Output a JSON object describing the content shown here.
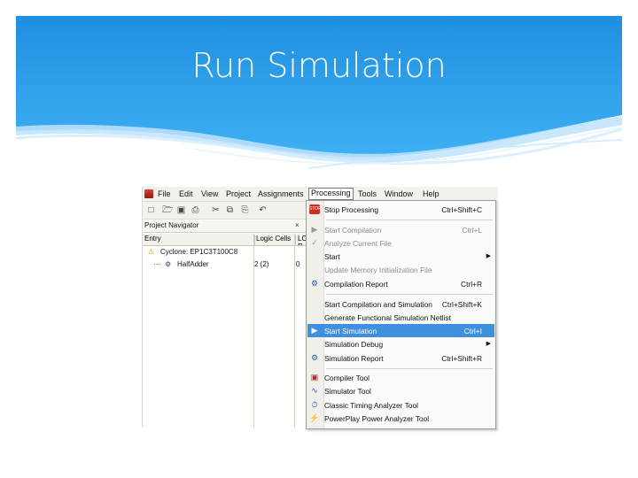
{
  "slide": {
    "title": "Run Simulation"
  },
  "colors": {
    "header_top": "#1f8fe0",
    "header_bottom": "#3fb0f3",
    "menu_highlight": "#3d8fe0"
  },
  "menubar": {
    "items": [
      "File",
      "Edit",
      "View",
      "Project",
      "Assignments",
      "Processing",
      "Tools",
      "Window",
      "Help"
    ],
    "active": "Processing"
  },
  "toolbar": {
    "icons": [
      "new-icon",
      "open-icon",
      "save-icon",
      "print-icon",
      "cut-icon",
      "copy-icon",
      "paste-icon",
      "undo-icon"
    ]
  },
  "project_navigator": {
    "title": "Project Navigator",
    "columns": [
      "Entry",
      "Logic Cells",
      "LC R"
    ],
    "rows": [
      {
        "entry": "Cyclone: EP1C3T100C8",
        "logic_cells": "",
        "lc": ""
      },
      {
        "entry": "HalfAdder",
        "logic_cells": "2 (2)",
        "lc": "0"
      }
    ]
  },
  "processing_menu": {
    "items": [
      {
        "label": "Stop Processing",
        "shortcut": "Ctrl+Shift+C",
        "icon": "stop-icon",
        "disabled": false
      },
      {
        "sep": true
      },
      {
        "label": "Start Compilation",
        "shortcut": "Ctrl+L",
        "icon": "play-icon",
        "disabled": true
      },
      {
        "label": "Analyze Current File",
        "shortcut": "",
        "icon": "analyze-icon",
        "disabled": true
      },
      {
        "label": "Start",
        "shortcut": "",
        "icon": "",
        "disabled": false,
        "submenu": true
      },
      {
        "label": "Update Memory Initialization File",
        "shortcut": "",
        "icon": "",
        "disabled": true
      },
      {
        "label": "Compilation Report",
        "shortcut": "Ctrl+R",
        "icon": "report-icon",
        "disabled": false
      },
      {
        "sep": true
      },
      {
        "label": "Start Compilation and Simulation",
        "shortcut": "Ctrl+Shift+K",
        "icon": "",
        "disabled": false
      },
      {
        "label": "Generate Functional Simulation Netlist",
        "shortcut": "",
        "icon": "",
        "disabled": false
      },
      {
        "label": "Start Simulation",
        "shortcut": "Ctrl+I",
        "icon": "simulate-icon",
        "disabled": false,
        "highlighted": true
      },
      {
        "label": "Simulation Debug",
        "shortcut": "",
        "icon": "",
        "disabled": false,
        "submenu": true
      },
      {
        "label": "Simulation Report",
        "shortcut": "Ctrl+Shift+R",
        "icon": "sim-report-icon",
        "disabled": false
      },
      {
        "sep": true
      },
      {
        "label": "Compiler Tool",
        "shortcut": "",
        "icon": "compiler-tool-icon",
        "disabled": false
      },
      {
        "label": "Simulator Tool",
        "shortcut": "",
        "icon": "simulator-tool-icon",
        "disabled": false
      },
      {
        "label": "Classic Timing Analyzer Tool",
        "shortcut": "",
        "icon": "timing-icon",
        "disabled": false
      },
      {
        "label": "PowerPlay Power Analyzer Tool",
        "shortcut": "",
        "icon": "power-icon",
        "disabled": false
      }
    ]
  }
}
